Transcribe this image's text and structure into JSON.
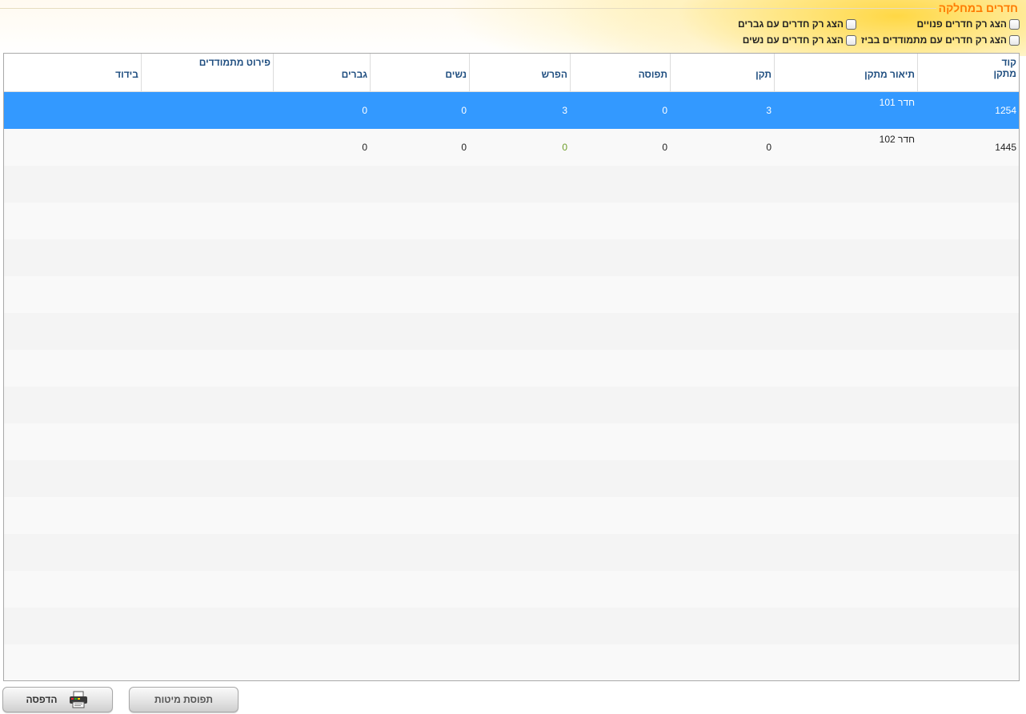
{
  "page_title": "חדרים במחלקה",
  "filters": [
    {
      "label": "הצג רק חדרים פנויים",
      "checked": false
    },
    {
      "label": "הצג רק חדרים עם גברים",
      "checked": false
    },
    {
      "label": "הצג רק חדרים עם מתמודדים בביז",
      "checked": false
    },
    {
      "label": "הצג רק חדרים עם נשים",
      "checked": false
    }
  ],
  "table": {
    "columns": [
      {
        "line1": "קוד",
        "line2": "מתקן"
      },
      {
        "line1": "תיאור מתקן"
      },
      {
        "line1": "תקן"
      },
      {
        "line1": "תפוסה"
      },
      {
        "line1": "הפרש"
      },
      {
        "line1": "נשים"
      },
      {
        "line1": "גברים"
      },
      {
        "line1": "פירוט מתמודדים"
      },
      {
        "line1": "בידוד"
      }
    ],
    "rows": [
      {
        "code": "1254",
        "description": "חדר 101",
        "standard": "3",
        "occupancy": "0",
        "difference": "3",
        "women": "0",
        "men": "0",
        "details": "",
        "isolation": "",
        "selected": true
      },
      {
        "code": "1445",
        "description": "חדר 102",
        "standard": "0",
        "occupancy": "0",
        "difference": "0",
        "women": "0",
        "men": "0",
        "details": "",
        "isolation": "",
        "selected": false
      }
    ],
    "empty_row_count": 14
  },
  "buttons": {
    "print_label": "הדפסה",
    "bed_occupancy_label": "תפוסת מיטות"
  },
  "colors": {
    "title": "#ff7a00",
    "header_text": "#1f4e80",
    "selected_row": "#3399ff",
    "positive_zero_diff": "#6e9e2a"
  }
}
